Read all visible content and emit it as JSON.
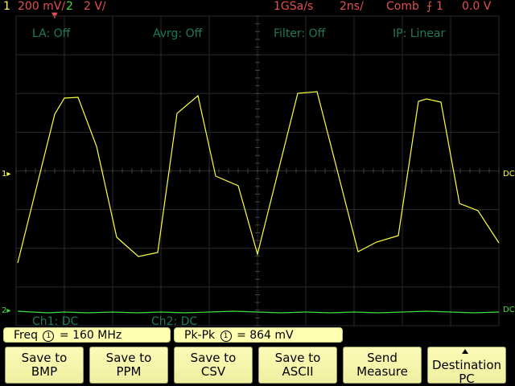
{
  "status": {
    "ch1_number": "1",
    "ch1_scale": "200 mV/",
    "ch2_number": "2",
    "ch2_scale": "2 V/",
    "sample_rate": "1GSa/s",
    "timebase": "2ns/",
    "trigger_mode": "Comb",
    "trigger_source": "1",
    "trigger_level": "0.0 V"
  },
  "grid_labels": {
    "la": "LA: Off",
    "avrg": "Avrg: Off",
    "filter": "Filter: Off",
    "ip": "IP: Linear"
  },
  "coupling": {
    "ch1": "Ch1: DC",
    "ch2": "Ch2: DC"
  },
  "markers": {
    "ch1_ground": "1",
    "ch2_ground": "2",
    "right_ch1": "DC",
    "right_ch2": "DC"
  },
  "measurements": {
    "freq_label": "Freq",
    "freq_value": "= 160 MHz",
    "pkpk_label": "Pk-Pk",
    "pkpk_value": "= 864 mV"
  },
  "softkeys": [
    {
      "line1": "Save to",
      "line2": "BMP"
    },
    {
      "line1": "Save to",
      "line2": "PPM"
    },
    {
      "line1": "Save to",
      "line2": "CSV"
    },
    {
      "line1": "Save to",
      "line2": "ASCII"
    },
    {
      "line1": "Send",
      "line2": "Measure"
    },
    {
      "line1": "Destination",
      "line2": "PC"
    }
  ],
  "colors": {
    "ch1": "#ffff40",
    "ch2": "#40e040",
    "status_red": "#e05050",
    "grid": "#2a2a2a",
    "softkey_bg": "#f5f5a8"
  }
}
